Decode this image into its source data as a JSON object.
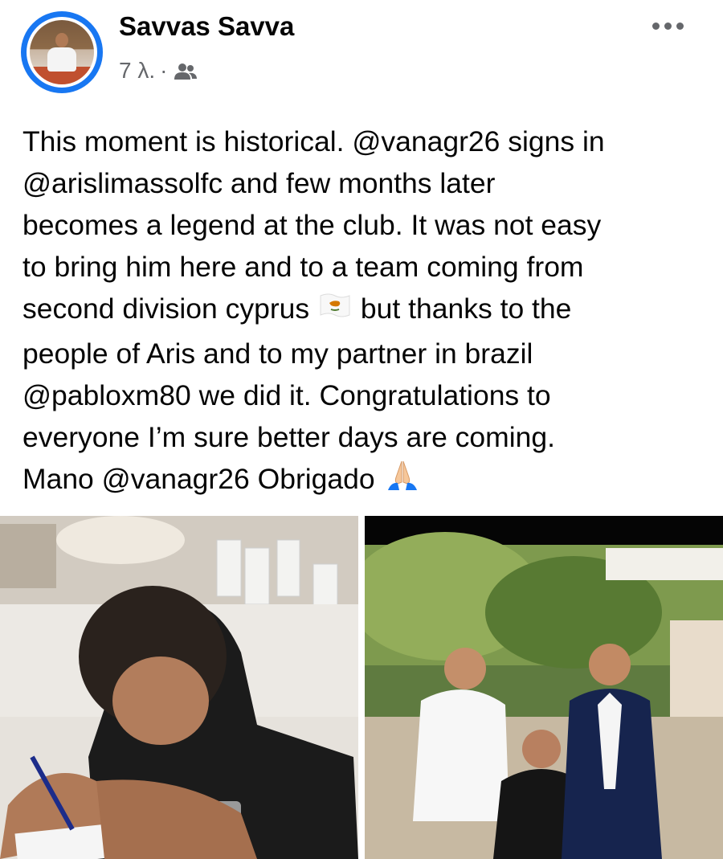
{
  "post": {
    "author": "Savvas Savva",
    "time": "7 λ.",
    "separator": "·",
    "audience_icon": "friends-icon",
    "more_icon": "more-options-icon",
    "lines": [
      "This moment is historical. @vanagr26 signs in",
      "@arislimassolfc  and few months later",
      "becomes a legend at the club. It was not easy",
      "to bring him here and to a team coming from",
      "second division cyprus",
      "but thanks to the",
      "people of Aris and to my partner in brazil",
      "@pabloxm80 we did it. Congratulations to",
      "everyone I’m sure better days are coming.",
      "Mano @vanagr26 Obrigado"
    ],
    "emojis": [
      "cyprus-flag-icon",
      "praying-hands-icon"
    ]
  },
  "photos": [
    {
      "name": "photo-signing-contract"
    },
    {
      "name": "photo-group-three-men"
    }
  ],
  "colors": {
    "accent": "#1877f2",
    "text": "#050505",
    "secondary": "#65676b"
  }
}
